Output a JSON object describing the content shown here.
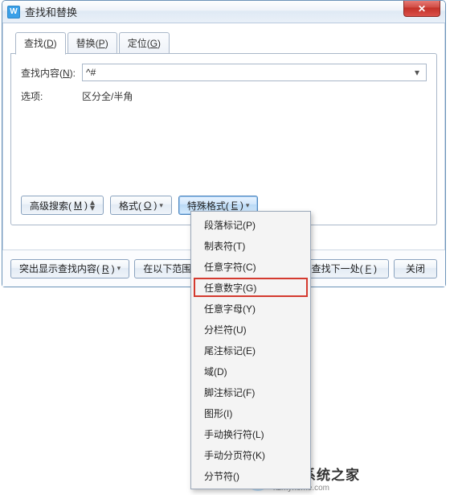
{
  "window": {
    "title": "查找和替换",
    "app_icon_letter": "W",
    "close_glyph": "✕"
  },
  "tabs": [
    {
      "label_pre": "查找(",
      "hotkey": "D",
      "label_post": ")"
    },
    {
      "label_pre": "替换(",
      "hotkey": "P",
      "label_post": ")"
    },
    {
      "label_pre": "定位(",
      "hotkey": "G",
      "label_post": ")"
    }
  ],
  "search": {
    "label_pre": "查找内容(",
    "hotkey": "N",
    "label_post": "):",
    "value": "^#",
    "drop_glyph": "▾"
  },
  "options": {
    "label": "选项:",
    "value": "区分全/半角"
  },
  "panel_buttons": {
    "advanced_pre": "高级搜索(",
    "advanced_hot": "M",
    "advanced_post": ")",
    "format_pre": "格式(",
    "format_hot": "O",
    "format_post": ")",
    "special_pre": "特殊格式(",
    "special_hot": "E",
    "special_post": ")",
    "caret": "▾",
    "updown": "▴▾"
  },
  "footer": {
    "highlight_pre": "突出显示查找内容(",
    "highlight_hot": "R",
    "highlight_post": ")",
    "in_range": "在以下范围中",
    "find_next_pre": "查找下一处(",
    "find_next_hot": "F",
    "find_next_post": ")",
    "close": "关闭",
    "caret": "▾"
  },
  "menu": {
    "items": [
      "段落标记(P)",
      "制表符(T)",
      "任意字符(C)",
      "任意数字(G)",
      "任意字母(Y)",
      "分栏符(U)",
      "尾注标记(E)",
      "域(D)",
      "脚注标记(F)",
      "图形(I)",
      "手动换行符(L)",
      "手动分页符(K)",
      "分节符()"
    ],
    "highlight_index": 3
  },
  "watermark": {
    "icon_text": "系",
    "line1": "纯净系统之家",
    "line2": "kzmyhome.com"
  }
}
